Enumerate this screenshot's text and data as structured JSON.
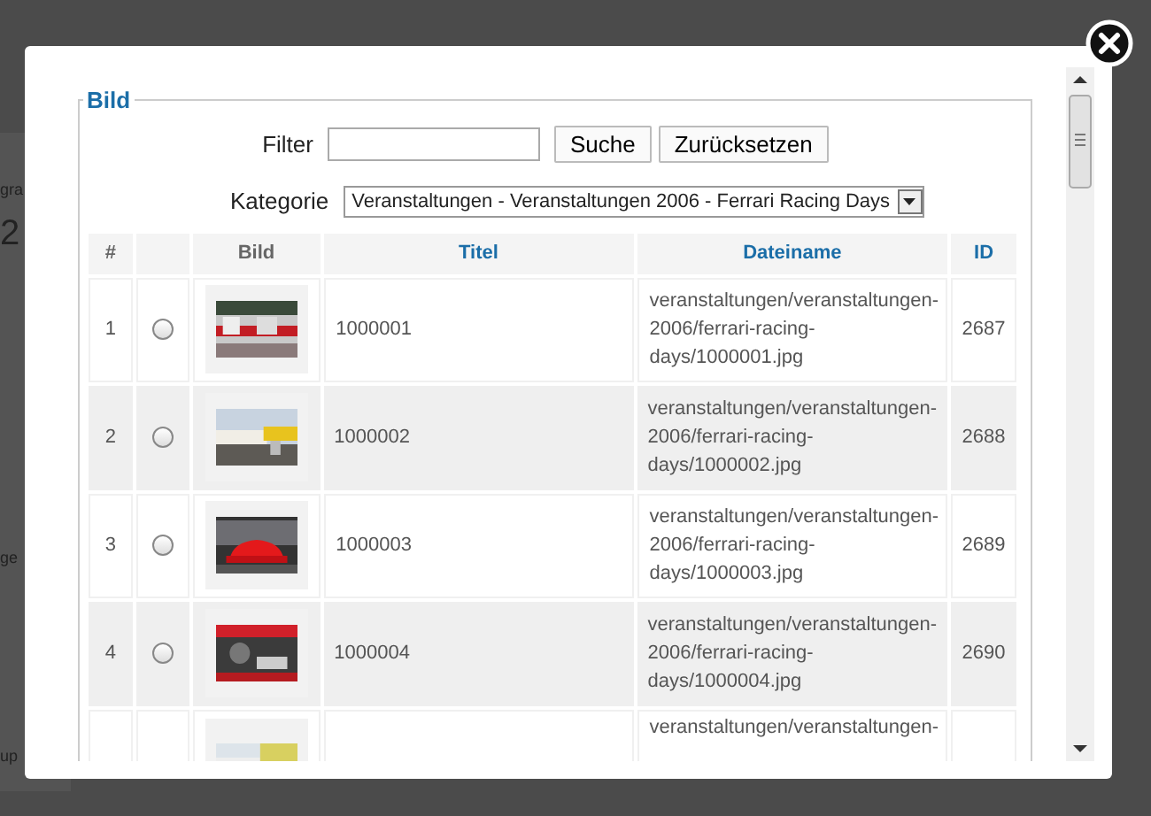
{
  "background_fragments": [
    "gra",
    "2",
    "ge",
    "up"
  ],
  "dialog": {
    "legend": "Bild",
    "filter": {
      "label": "Filter",
      "buttons": [
        "Suche",
        "Zurücksetzen"
      ]
    },
    "category": {
      "label": "Kategorie",
      "value": "Veranstaltungen - Veranstaltungen 2006 - Ferrari Racing Days"
    },
    "table": {
      "columns": [
        {
          "label": "#",
          "sortable": false
        },
        {
          "sortable": false
        },
        {
          "label": "Bild",
          "sortable": false
        },
        {
          "label": "Titel",
          "sortable": true
        },
        {
          "label": "Dateiname",
          "sortable": true
        },
        {
          "label": "ID",
          "sortable": true
        }
      ],
      "rows": [
        {
          "number": "1",
          "selected": false,
          "title": "1000001",
          "filename": "veranstaltungen/veranstaltungen-2006/ferrari-racing-days/1000001.jpg",
          "id": "2687"
        },
        {
          "number": "2",
          "selected": false,
          "title": "1000002",
          "filename": "veranstaltungen/veranstaltungen-2006/ferrari-racing-days/1000002.jpg",
          "id": "2688"
        },
        {
          "number": "3",
          "selected": false,
          "title": "1000003",
          "filename": "veranstaltungen/veranstaltungen-2006/ferrari-racing-days/1000003.jpg",
          "id": "2689"
        },
        {
          "number": "4",
          "selected": false,
          "title": "1000004",
          "filename": "veranstaltungen/veranstaltungen-2006/ferrari-racing-days/1000004.jpg",
          "id": "2690"
        },
        {
          "filename": "veranstaltungen/veranstaltungen-"
        }
      ]
    }
  }
}
